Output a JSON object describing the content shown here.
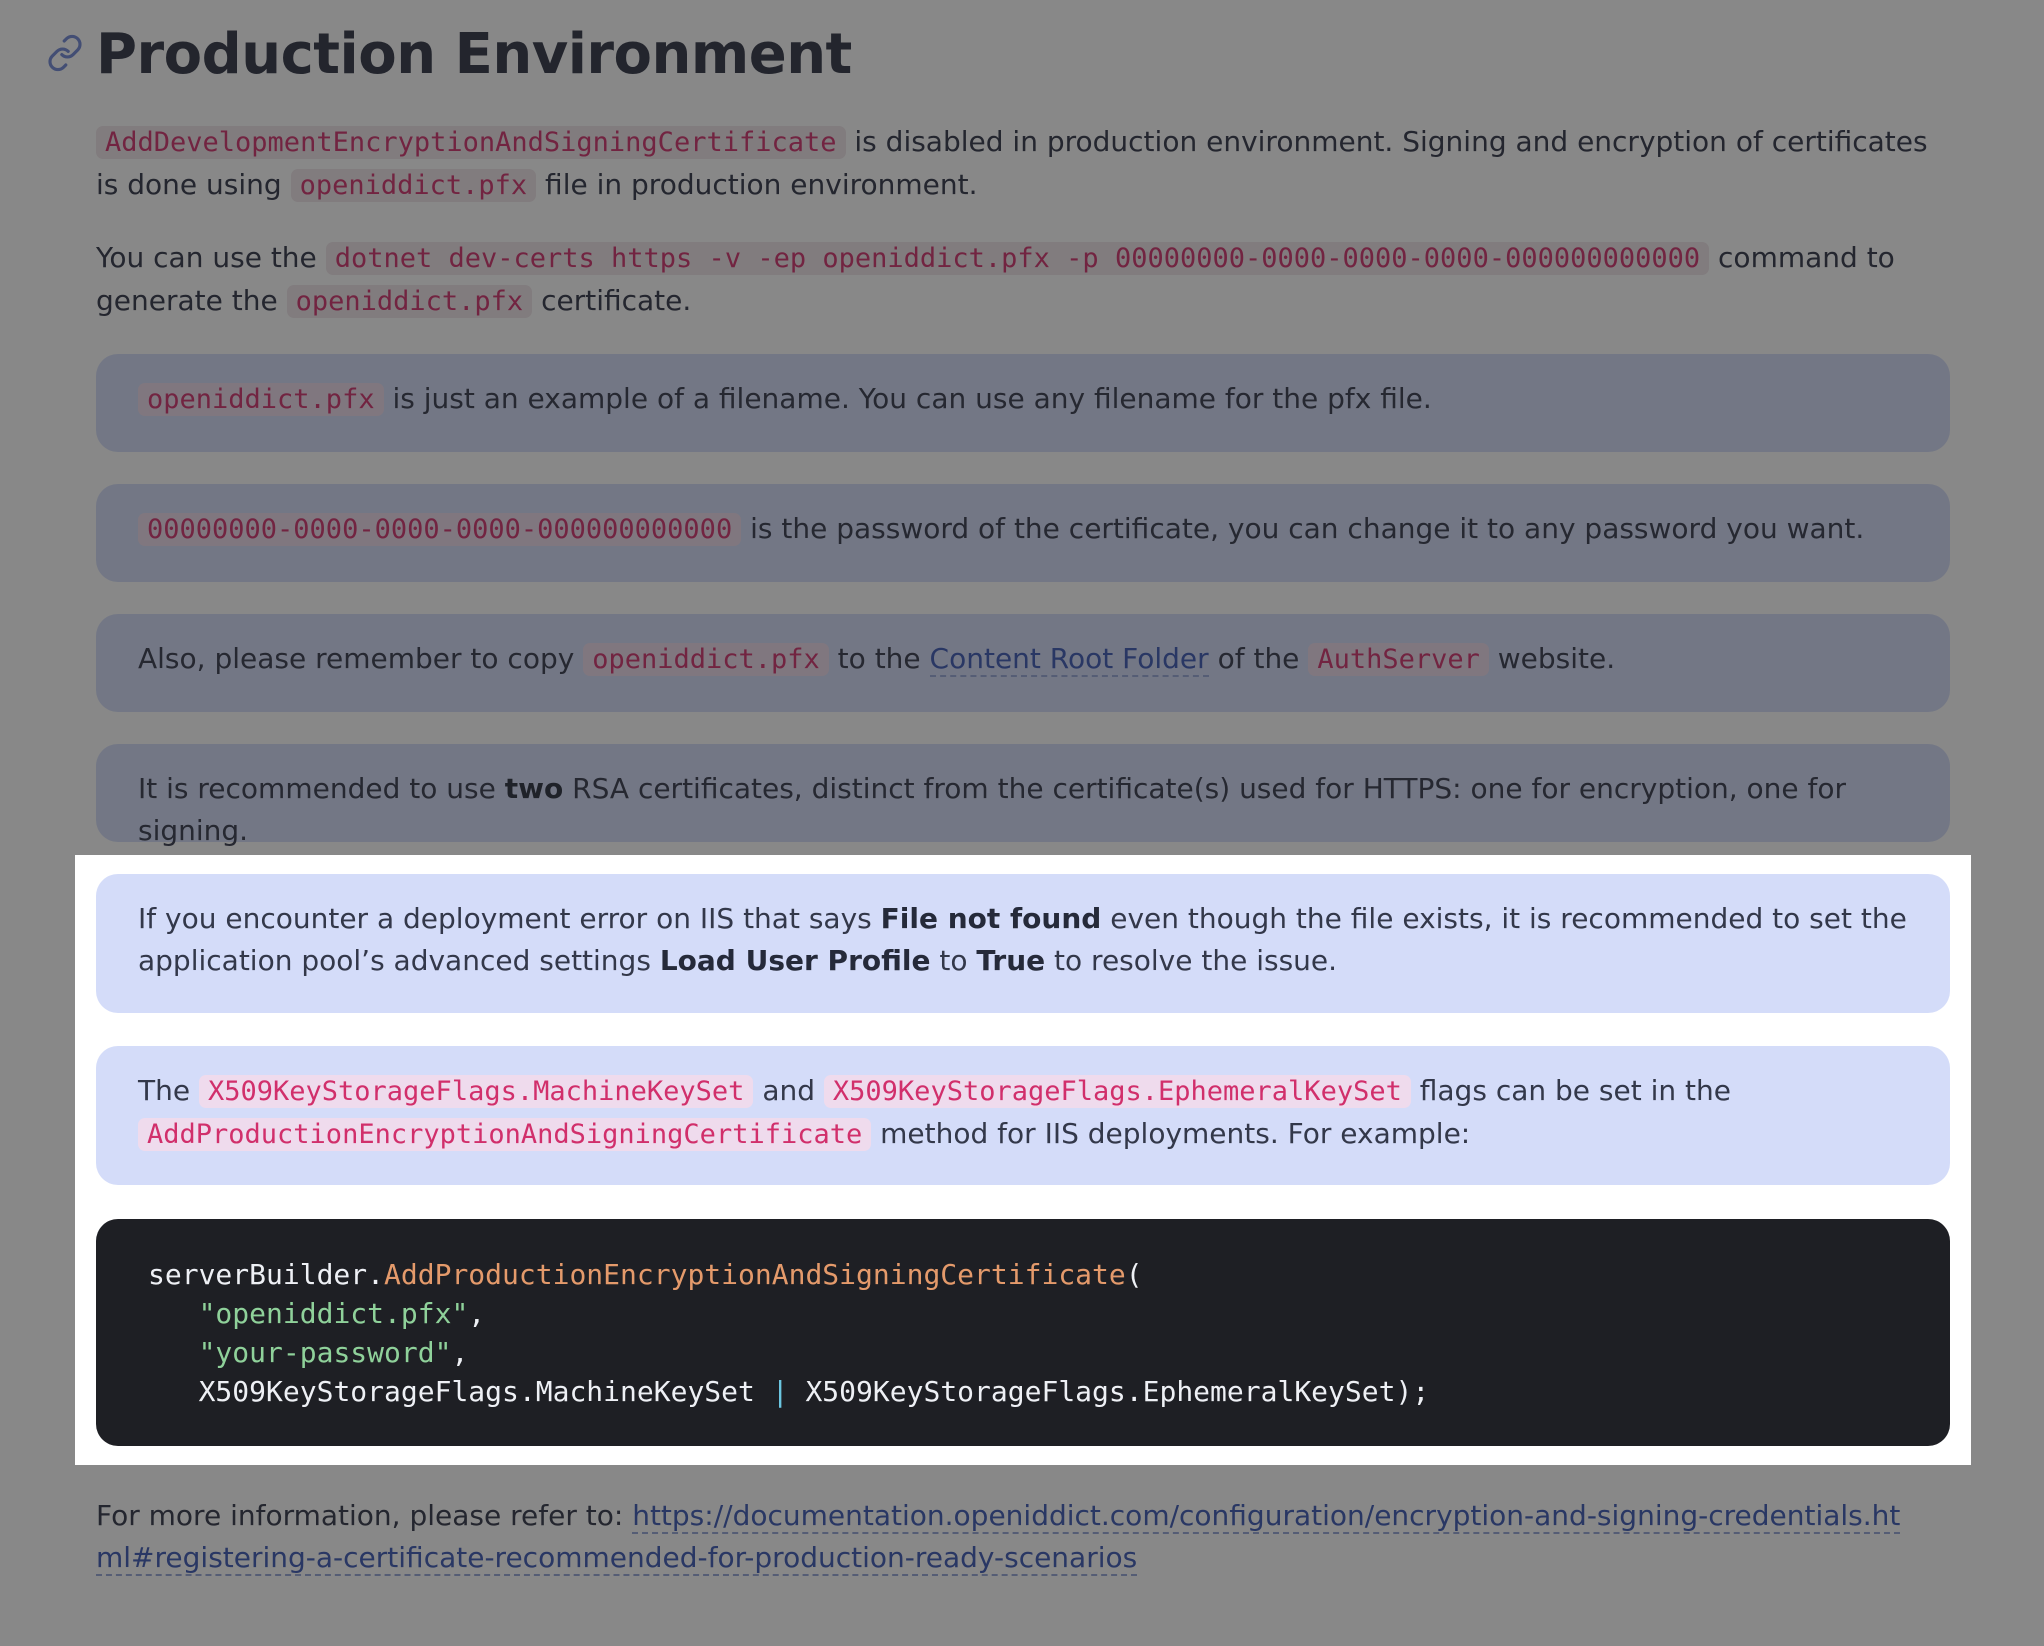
{
  "heading": {
    "title": "Production Environment",
    "anchor_icon": "link-icon"
  },
  "para1": {
    "code_dev_cert": "AddDevelopmentEncryptionAndSigningCertificate",
    "text1": " is disabled in production environment. Signing and encryption of certificates is done using ",
    "code_pfx": "openiddict.pfx",
    "text2": " file in production environment."
  },
  "para2": {
    "text1": "You can use the ",
    "code_command": "dotnet dev-certs https -v -ep openiddict.pfx -p 00000000-0000-0000-0000-000000000000",
    "text2": " command to generate the ",
    "code_pfx": "openiddict.pfx",
    "text3": " certificate."
  },
  "notes": {
    "filename": {
      "code": "openiddict.pfx",
      "text": " is just an example of a filename. You can use any filename for the pfx file."
    },
    "password": {
      "code": "00000000-0000-0000-0000-000000000000",
      "text": " is the password of the certificate, you can change it to any password you want."
    },
    "copy": {
      "text1": "Also, please remember to copy ",
      "code_pfx": "openiddict.pfx",
      "text2": " to the ",
      "link": "Content Root Folder",
      "text3": " of the ",
      "code_server": "AuthServer",
      "text4": " website."
    },
    "rsa": {
      "text1": "It is recommended to use ",
      "bold": "two",
      "text2": " RSA certificates, distinct from the certificate(s) used for HTTPS: one for encryption, one for signing."
    },
    "iis": {
      "text1": "If you encounter a deployment error on IIS that says ",
      "bold1": "File not found",
      "text2": " even though the file exists, it is recommended to set the application pool’s advanced settings ",
      "bold2": "Load User Profile",
      "text3": " to ",
      "bold3": "True",
      "text4": " to resolve the issue."
    },
    "flags": {
      "text1": "The ",
      "code1": "X509KeyStorageFlags.MachineKeySet",
      "text2": " and ",
      "code2": "X509KeyStorageFlags.EphemeralKeySet",
      "text3": " flags can be set in the ",
      "code3": "AddProductionEncryptionAndSigningCertificate",
      "text4": " method for IIS deployments. For example:"
    }
  },
  "code_block": {
    "l1_obj": "serverBuilder.",
    "l1_method": "AddProductionEncryptionAndSigningCertificate",
    "l1_paren": "(",
    "l2_indent": "   ",
    "l2_string": "\"openiddict.pfx\"",
    "l2_comma": ",",
    "l3_indent": "   ",
    "l3_string": "\"your-password\"",
    "l3_comma": ",",
    "l4_indent": "   ",
    "l4_a": "X509KeyStorageFlags.MachineKeySet",
    "l4_op": " | ",
    "l4_b": "X509KeyStorageFlags.EphemeralKeySet);"
  },
  "footer": {
    "text": "For more information, please refer to: ",
    "link": "https://documentation.openiddict.com/configuration/encryption-and-signing-credentials.html#registering-a-certificate-recommended-for-production-ready-scenarios"
  },
  "colors": {
    "note_background": "#d4dcf9",
    "inline_code": "#d12f6b",
    "code_background": "#1e1f24",
    "link": "#3a57b3",
    "dim_overlay": "rgba(26,26,26,0.52)"
  }
}
